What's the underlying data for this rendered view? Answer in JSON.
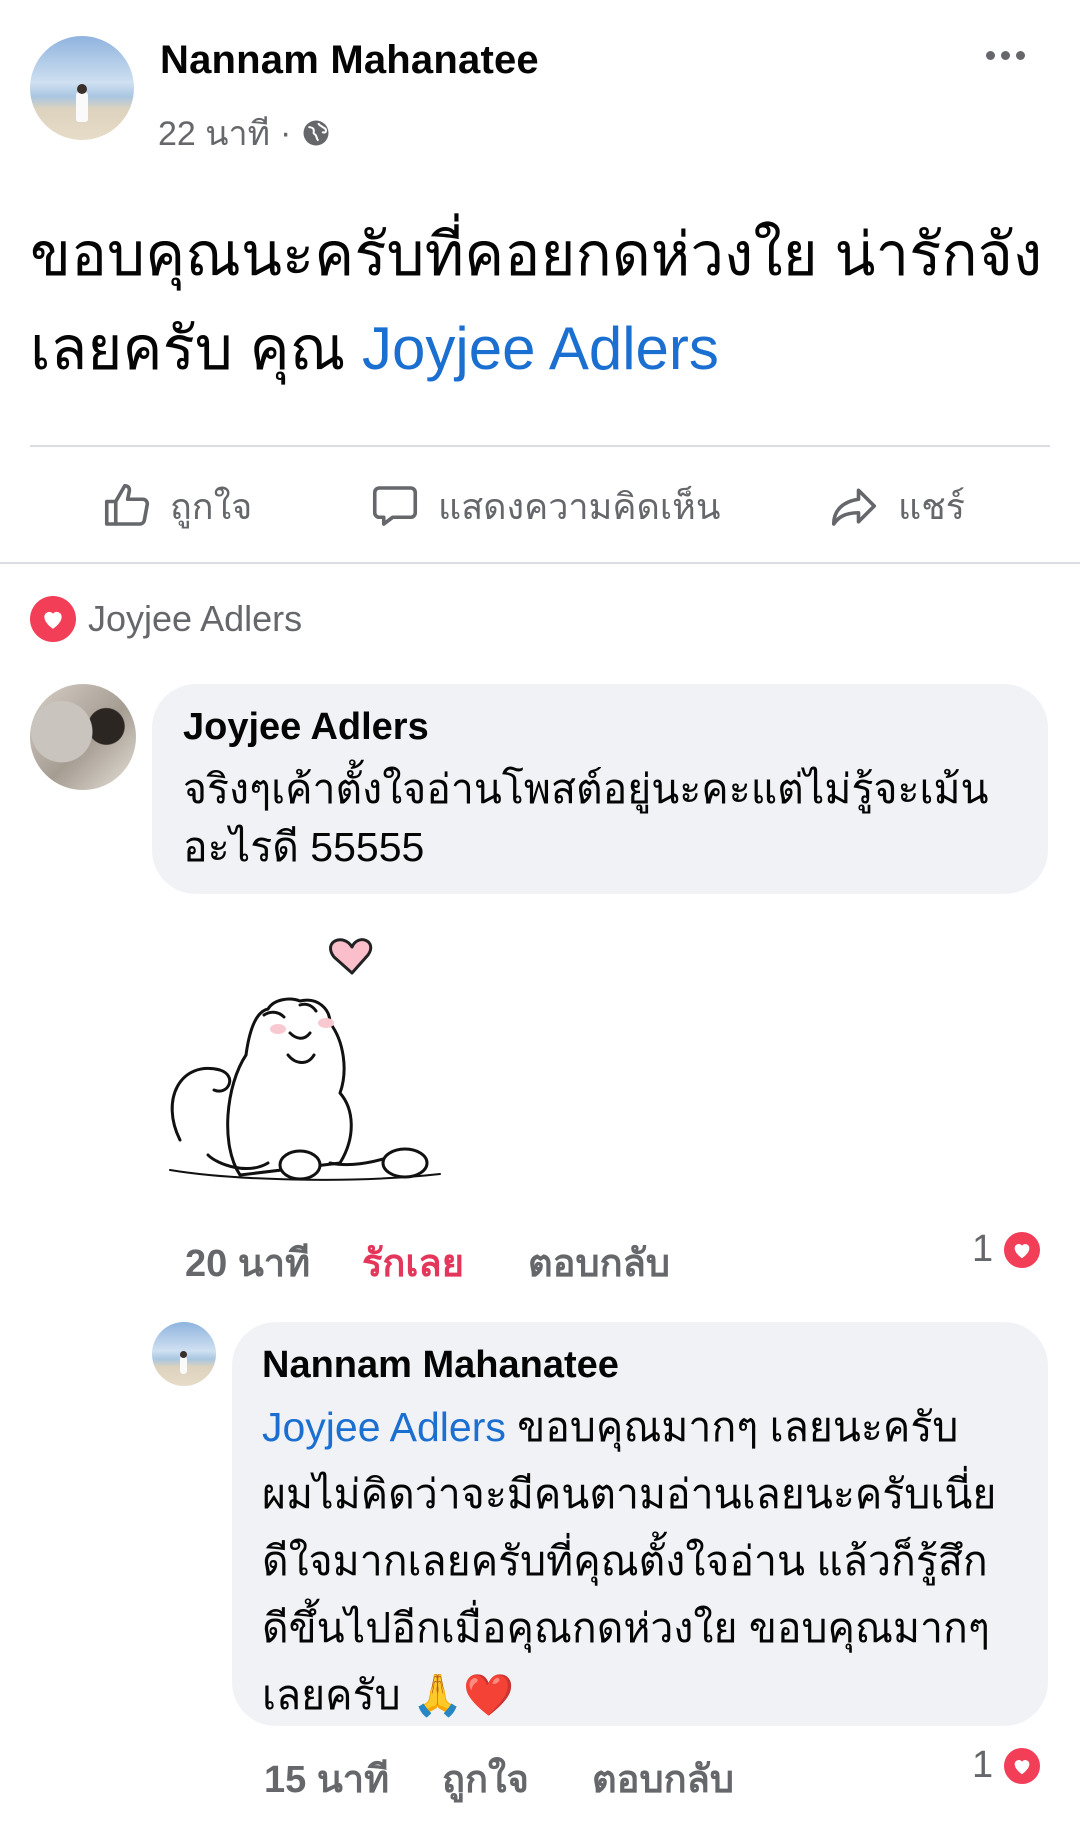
{
  "post": {
    "author": "Nannam Mahanatee",
    "time": "22 นาที",
    "separator": "·",
    "text_part1": "ขอบคุณนะครับที่คอยกดห่วงใย น่ารักจังเลยครับ คุณ ",
    "text_mention": "Joyjee Adlers"
  },
  "actions": {
    "like": "ถูกใจ",
    "comment": "แสดงความคิดเห็น",
    "share": "แชร์"
  },
  "reaction_summary": {
    "name": "Joyjee Adlers"
  },
  "comment1": {
    "author": "Joyjee Adlers",
    "text": "จริงๆเค้าตั้งใจอ่านโพสต์อยู่นะคะแต่ไม่รู้จะเม้นอะไรดี 55555",
    "time": "20 นาที",
    "love_label": "รักเลย",
    "reply_label": "ตอบกลับ",
    "reaction_count": "1"
  },
  "reply1": {
    "author": "Nannam Mahanatee",
    "mention": "Joyjee Adlers",
    "text": " ขอบคุณมากๆ เลยนะครับ ผมไม่คิดว่าจะมีคนตามอ่านเลยนะครับเนี่ย ดีใจมากเลยครับที่คุณตั้งใจอ่าน แล้วก็รู้สึกดีขึ้นไปอีกเมื่อคุณกดห่วงใย ขอบคุณมากๆ เลยครับ 🙏❤️",
    "time": "15 นาที",
    "like_label": "ถูกใจ",
    "reply_label": "ตอบกลับ",
    "reaction_count": "1"
  },
  "colors": {
    "link": "#1b6fd1",
    "love": "#e3365a",
    "bubble": "#f0f2f5",
    "muted": "#65676b"
  },
  "icons": [
    "more-icon",
    "globe-icon",
    "like-thumb-icon",
    "comment-icon",
    "share-icon",
    "love-reaction-icon",
    "cat-sticker"
  ]
}
